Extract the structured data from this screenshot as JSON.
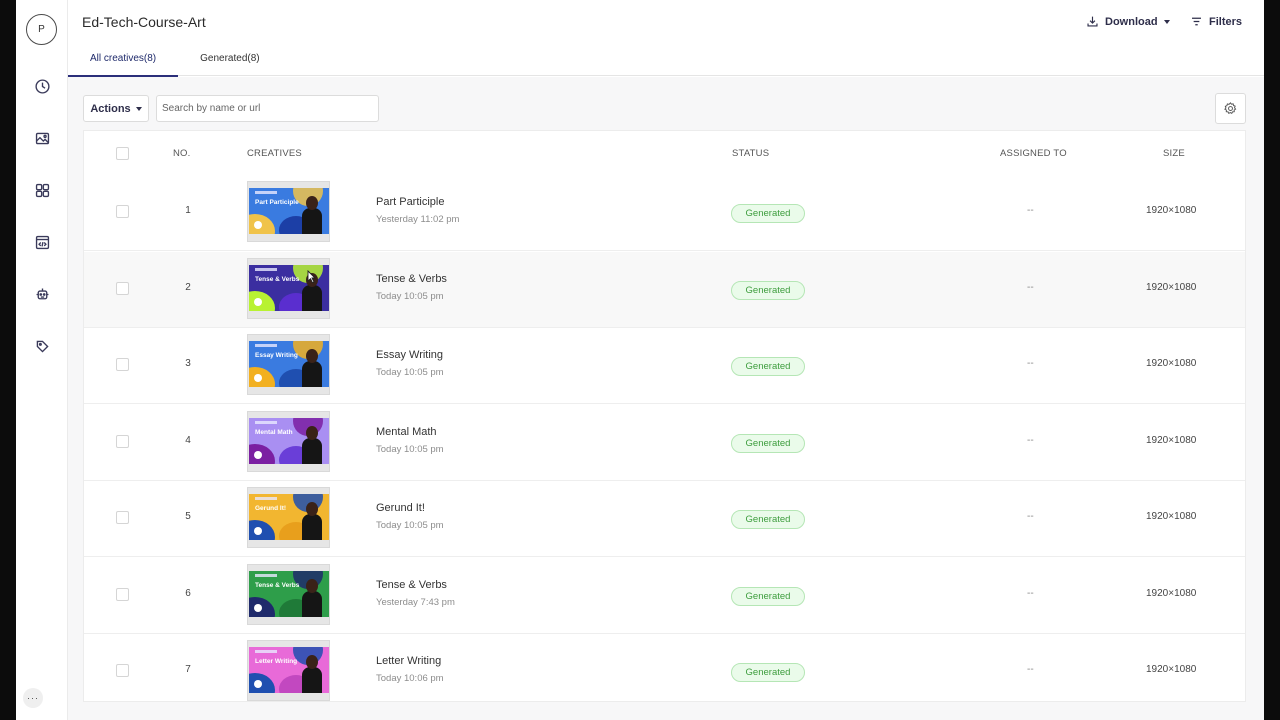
{
  "sidebar": {
    "avatar_letter": "P",
    "icons": [
      "clock-icon",
      "gallery-icon",
      "grid-icon",
      "code-icon",
      "robot-icon",
      "tag-icon"
    ],
    "more_label": "···"
  },
  "header": {
    "title": "Ed-Tech-Course-Art",
    "download_label": "Download",
    "filters_label": "Filters",
    "tabs": [
      {
        "label": "All creatives(8)",
        "active": true
      },
      {
        "label": "Generated(8)",
        "active": false
      }
    ]
  },
  "toolbar": {
    "actions_label": "Actions",
    "search_placeholder": "Search by name or url"
  },
  "table": {
    "columns": {
      "no": "NO.",
      "creatives": "CREATIVES",
      "status": "STATUS",
      "assigned": "ASSIGNED TO",
      "size": "SIZE"
    },
    "rows": [
      {
        "no": "1",
        "name": "Part Participle",
        "time": "Yesterday 11:02 pm",
        "status": "Generated",
        "assigned": "--",
        "size": "1920×1080",
        "thumb_title": "Part Participle",
        "thumb_colors": [
          "#3a7be0",
          "#f0c34a",
          "#1c3fa6"
        ]
      },
      {
        "no": "2",
        "name": "Tense & Verbs",
        "time": "Today 10:05 pm",
        "status": "Generated",
        "assigned": "--",
        "size": "1920×1080",
        "thumb_title": "Tense & Verbs",
        "thumb_colors": [
          "#3b2ea0",
          "#b8f232",
          "#5a2ecf"
        ]
      },
      {
        "no": "3",
        "name": "Essay Writing",
        "time": "Today 10:05 pm",
        "status": "Generated",
        "assigned": "--",
        "size": "1920×1080",
        "thumb_title": "Essay Writing",
        "thumb_colors": [
          "#3a7be0",
          "#f2b020",
          "#1f4fb0"
        ]
      },
      {
        "no": "4",
        "name": "Mental Math",
        "time": "Today 10:05 pm",
        "status": "Generated",
        "assigned": "--",
        "size": "1920×1080",
        "thumb_title": "Mental Math",
        "thumb_colors": [
          "#a98ff2",
          "#7b1fa2",
          "#6a3ed8"
        ]
      },
      {
        "no": "5",
        "name": "Gerund It!",
        "time": "Today 10:05 pm",
        "status": "Generated",
        "assigned": "--",
        "size": "1920×1080",
        "thumb_title": "Gerund It!",
        "thumb_colors": [
          "#f2b630",
          "#1f4fb0",
          "#e89f1c"
        ]
      },
      {
        "no": "6",
        "name": "Tense & Verbs",
        "time": "Yesterday 7:43 pm",
        "status": "Generated",
        "assigned": "--",
        "size": "1920×1080",
        "thumb_title": "Tense & Verbs",
        "thumb_colors": [
          "#2e9e4a",
          "#1f2a6b",
          "#1f7a38"
        ]
      },
      {
        "no": "7",
        "name": "Letter Writing",
        "time": "Today 10:06 pm",
        "status": "Generated",
        "assigned": "--",
        "size": "1920×1080",
        "thumb_title": "Letter Writing",
        "thumb_colors": [
          "#e86ad8",
          "#1f4fb0",
          "#c248c0"
        ]
      }
    ]
  },
  "colors": {
    "accent": "#2b2f7a",
    "status_bg": "#eafbea",
    "status_text": "#3e9d3e"
  }
}
